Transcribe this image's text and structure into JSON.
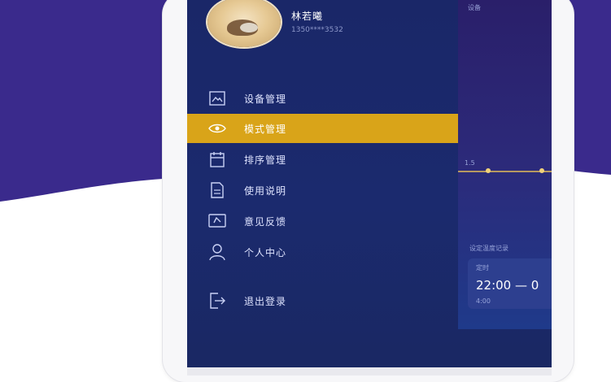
{
  "colors": {
    "background_wave": "#3a2a8c",
    "drawer": "#1b2a6e",
    "active_item": "#d9a419",
    "menu_text": "#dfe4ff"
  },
  "profile": {
    "name": "林若曦",
    "phone": "1350****3532"
  },
  "menu": {
    "items": [
      {
        "label": "设备管理",
        "icon": "image-icon"
      },
      {
        "label": "模式管理",
        "icon": "eye-icon"
      },
      {
        "label": "排序管理",
        "icon": "calendar-icon"
      },
      {
        "label": "使用说明",
        "icon": "document-icon"
      },
      {
        "label": "意见反馈",
        "icon": "feedback-icon"
      },
      {
        "label": "个人中心",
        "icon": "user-icon"
      },
      {
        "label": "退出登录",
        "icon": "logout-icon"
      }
    ],
    "active_index": 1
  },
  "app_peek": {
    "time": "22:00 — 0",
    "small_labels": [
      "设备",
      "1.5",
      "设定温度记录",
      "定时",
      "4:00"
    ]
  }
}
